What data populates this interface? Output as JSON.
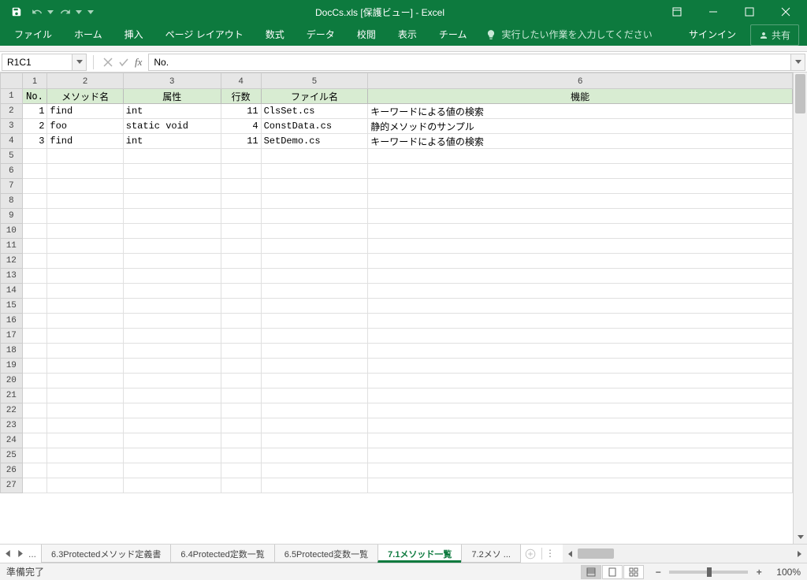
{
  "title": "DocCs.xls  [保護ビュー] - Excel",
  "qat": {
    "save": "保存",
    "undo": "元に戻す",
    "redo": "やり直し"
  },
  "ribbon": {
    "tabs": [
      "ファイル",
      "ホーム",
      "挿入",
      "ページ レイアウト",
      "数式",
      "データ",
      "校閲",
      "表示",
      "チーム"
    ],
    "tell_me": "実行したい作業を入力してください",
    "signin": "サインイン",
    "share": "共有"
  },
  "formula_bar": {
    "name_box": "R1C1",
    "formula": "No."
  },
  "columns": {
    "labels": [
      "1",
      "2",
      "3",
      "4",
      "5",
      "6"
    ],
    "widths": [
      32,
      98,
      126,
      52,
      138,
      560
    ]
  },
  "header_row": [
    "No.",
    "メソッド名",
    "属性",
    "行数",
    "ファイル名",
    "機能"
  ],
  "rows": [
    {
      "no": "1",
      "method": "find",
      "attr": "int",
      "lines": "11",
      "file": "ClsSet.cs",
      "func": "キーワードによる値の検索"
    },
    {
      "no": "2",
      "method": "foo",
      "attr": "static void",
      "lines": "4",
      "file": "ConstData.cs",
      "func": "静的メソッドのサンプル"
    },
    {
      "no": "3",
      "method": "find",
      "attr": "int",
      "lines": "11",
      "file": "SetDemo.cs",
      "func": "キーワードによる値の検索"
    }
  ],
  "row_count_displayed": 27,
  "sheet_tabs": {
    "overflow": "...",
    "tabs": [
      "6.3Protectedメソッド定義書",
      "6.4Protected定数一覧",
      "6.5Protected変数一覧",
      "7.1メソッド一覧",
      "7.2メソ ..."
    ],
    "active_index": 3
  },
  "statusbar": {
    "status": "準備完了",
    "zoom": "100%"
  }
}
